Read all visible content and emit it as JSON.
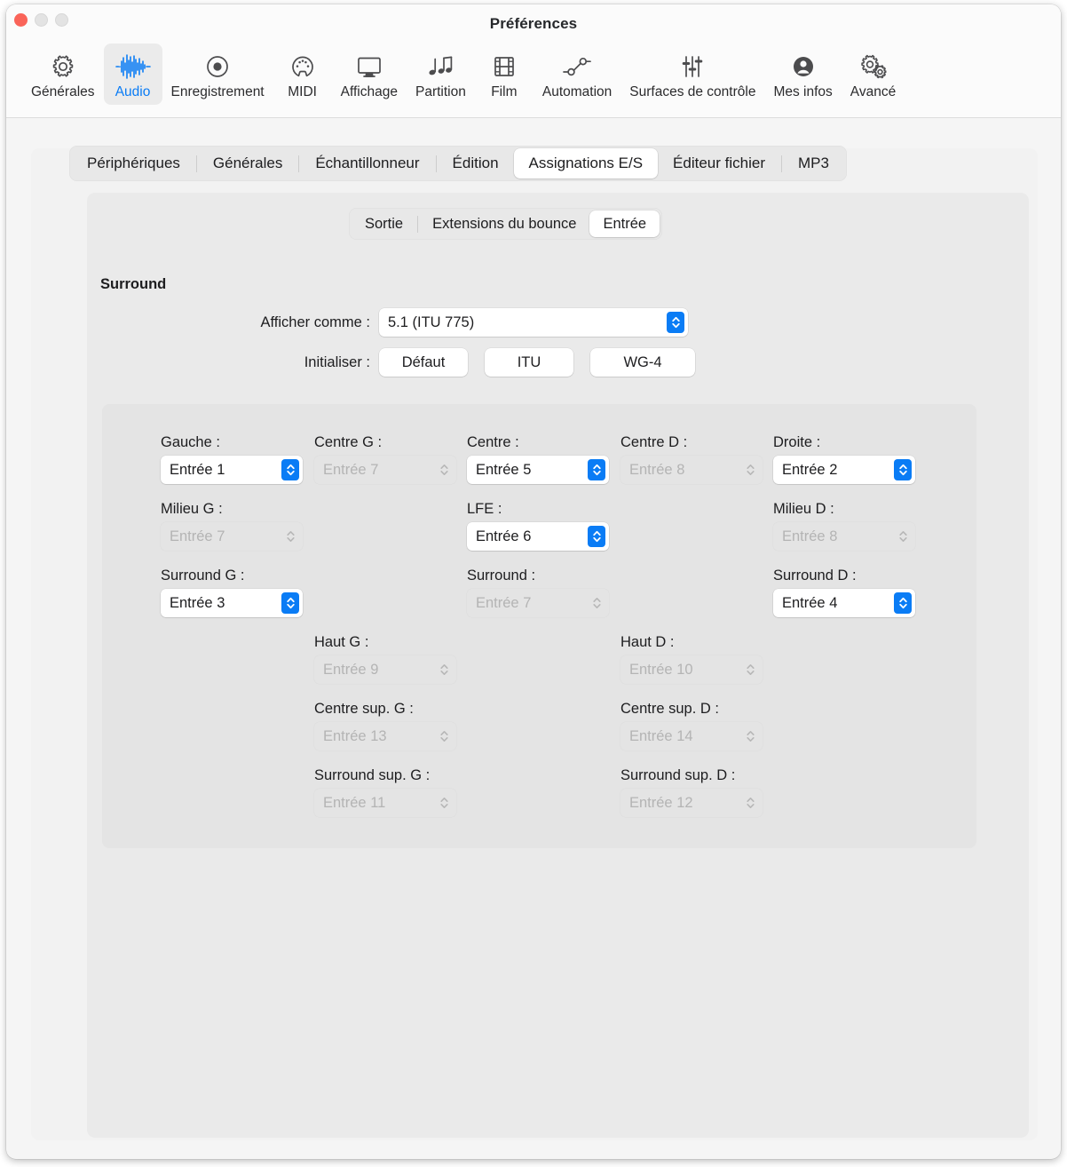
{
  "window": {
    "title": "Préférences",
    "traffic_lights": [
      "close",
      "minimize",
      "zoom"
    ]
  },
  "toolbar": {
    "items": [
      {
        "label": "Générales",
        "icon": "gear-icon",
        "selected": false
      },
      {
        "label": "Audio",
        "icon": "waveform-icon",
        "selected": true
      },
      {
        "label": "Enregistrement",
        "icon": "record-circle-icon",
        "selected": false
      },
      {
        "label": "MIDI",
        "icon": "midi-connector-icon",
        "selected": false
      },
      {
        "label": "Affichage",
        "icon": "display-icon",
        "selected": false
      },
      {
        "label": "Partition",
        "icon": "music-notes-icon",
        "selected": false
      },
      {
        "label": "Film",
        "icon": "film-strip-icon",
        "selected": false
      },
      {
        "label": "Automation",
        "icon": "automation-nodes-icon",
        "selected": false
      },
      {
        "label": "Surfaces de contrôle",
        "icon": "sliders-icon",
        "selected": false
      },
      {
        "label": "Mes infos",
        "icon": "person-circle-icon",
        "selected": false
      },
      {
        "label": "Avancé",
        "icon": "double-gear-icon",
        "selected": false
      }
    ],
    "accent_color": "#0a7cf5"
  },
  "tabs_main": {
    "items": [
      {
        "label": "Périphériques",
        "active": false
      },
      {
        "label": "Générales",
        "active": false
      },
      {
        "label": "Échantillonneur",
        "active": false
      },
      {
        "label": "Édition",
        "active": false
      },
      {
        "label": "Assignations E/S",
        "active": true
      },
      {
        "label": "Éditeur fichier",
        "active": false
      },
      {
        "label": "MP3",
        "active": false
      }
    ]
  },
  "tabs_sub": {
    "items": [
      {
        "label": "Sortie",
        "active": false
      },
      {
        "label": "Extensions du bounce",
        "active": false
      },
      {
        "label": "Entrée",
        "active": true
      }
    ]
  },
  "surround": {
    "section_title": "Surround",
    "afficher_label": "Afficher comme :",
    "afficher_value": "5.1 (ITU 775)",
    "initialiser_label": "Initialiser :",
    "btn_defaut": "Défaut",
    "btn_itu": "ITU",
    "btn_wg4": "WG-4",
    "channels": [
      {
        "key": "gauche",
        "label": "Gauche :",
        "value": "Entrée 1",
        "enabled": true
      },
      {
        "key": "centre_g",
        "label": "Centre G :",
        "value": "Entrée 7",
        "enabled": false
      },
      {
        "key": "centre",
        "label": "Centre :",
        "value": "Entrée 5",
        "enabled": true
      },
      {
        "key": "centre_d",
        "label": "Centre D :",
        "value": "Entrée 8",
        "enabled": false
      },
      {
        "key": "droite",
        "label": "Droite :",
        "value": "Entrée 2",
        "enabled": true
      },
      {
        "key": "milieu_g",
        "label": "Milieu G :",
        "value": "Entrée 7",
        "enabled": false
      },
      {
        "key": "lfe",
        "label": "LFE :",
        "value": "Entrée 6",
        "enabled": true
      },
      {
        "key": "milieu_d",
        "label": "Milieu D :",
        "value": "Entrée 8",
        "enabled": false
      },
      {
        "key": "surround_g",
        "label": "Surround G :",
        "value": "Entrée 3",
        "enabled": true
      },
      {
        "key": "surround",
        "label": "Surround :",
        "value": "Entrée 7",
        "enabled": false
      },
      {
        "key": "surround_d",
        "label": "Surround D :",
        "value": "Entrée 4",
        "enabled": true
      },
      {
        "key": "haut_g",
        "label": "Haut G :",
        "value": "Entrée 9",
        "enabled": false
      },
      {
        "key": "haut_d",
        "label": "Haut D :",
        "value": "Entrée 10",
        "enabled": false
      },
      {
        "key": "centre_sup_g",
        "label": "Centre sup. G :",
        "value": "Entrée 13",
        "enabled": false
      },
      {
        "key": "centre_sup_d",
        "label": "Centre sup. D :",
        "value": "Entrée 14",
        "enabled": false
      },
      {
        "key": "surround_sup_g",
        "label": "Surround sup. G :",
        "value": "Entrée 11",
        "enabled": false
      },
      {
        "key": "surround_sup_d",
        "label": "Surround sup. D :",
        "value": "Entrée 12",
        "enabled": false
      }
    ]
  }
}
